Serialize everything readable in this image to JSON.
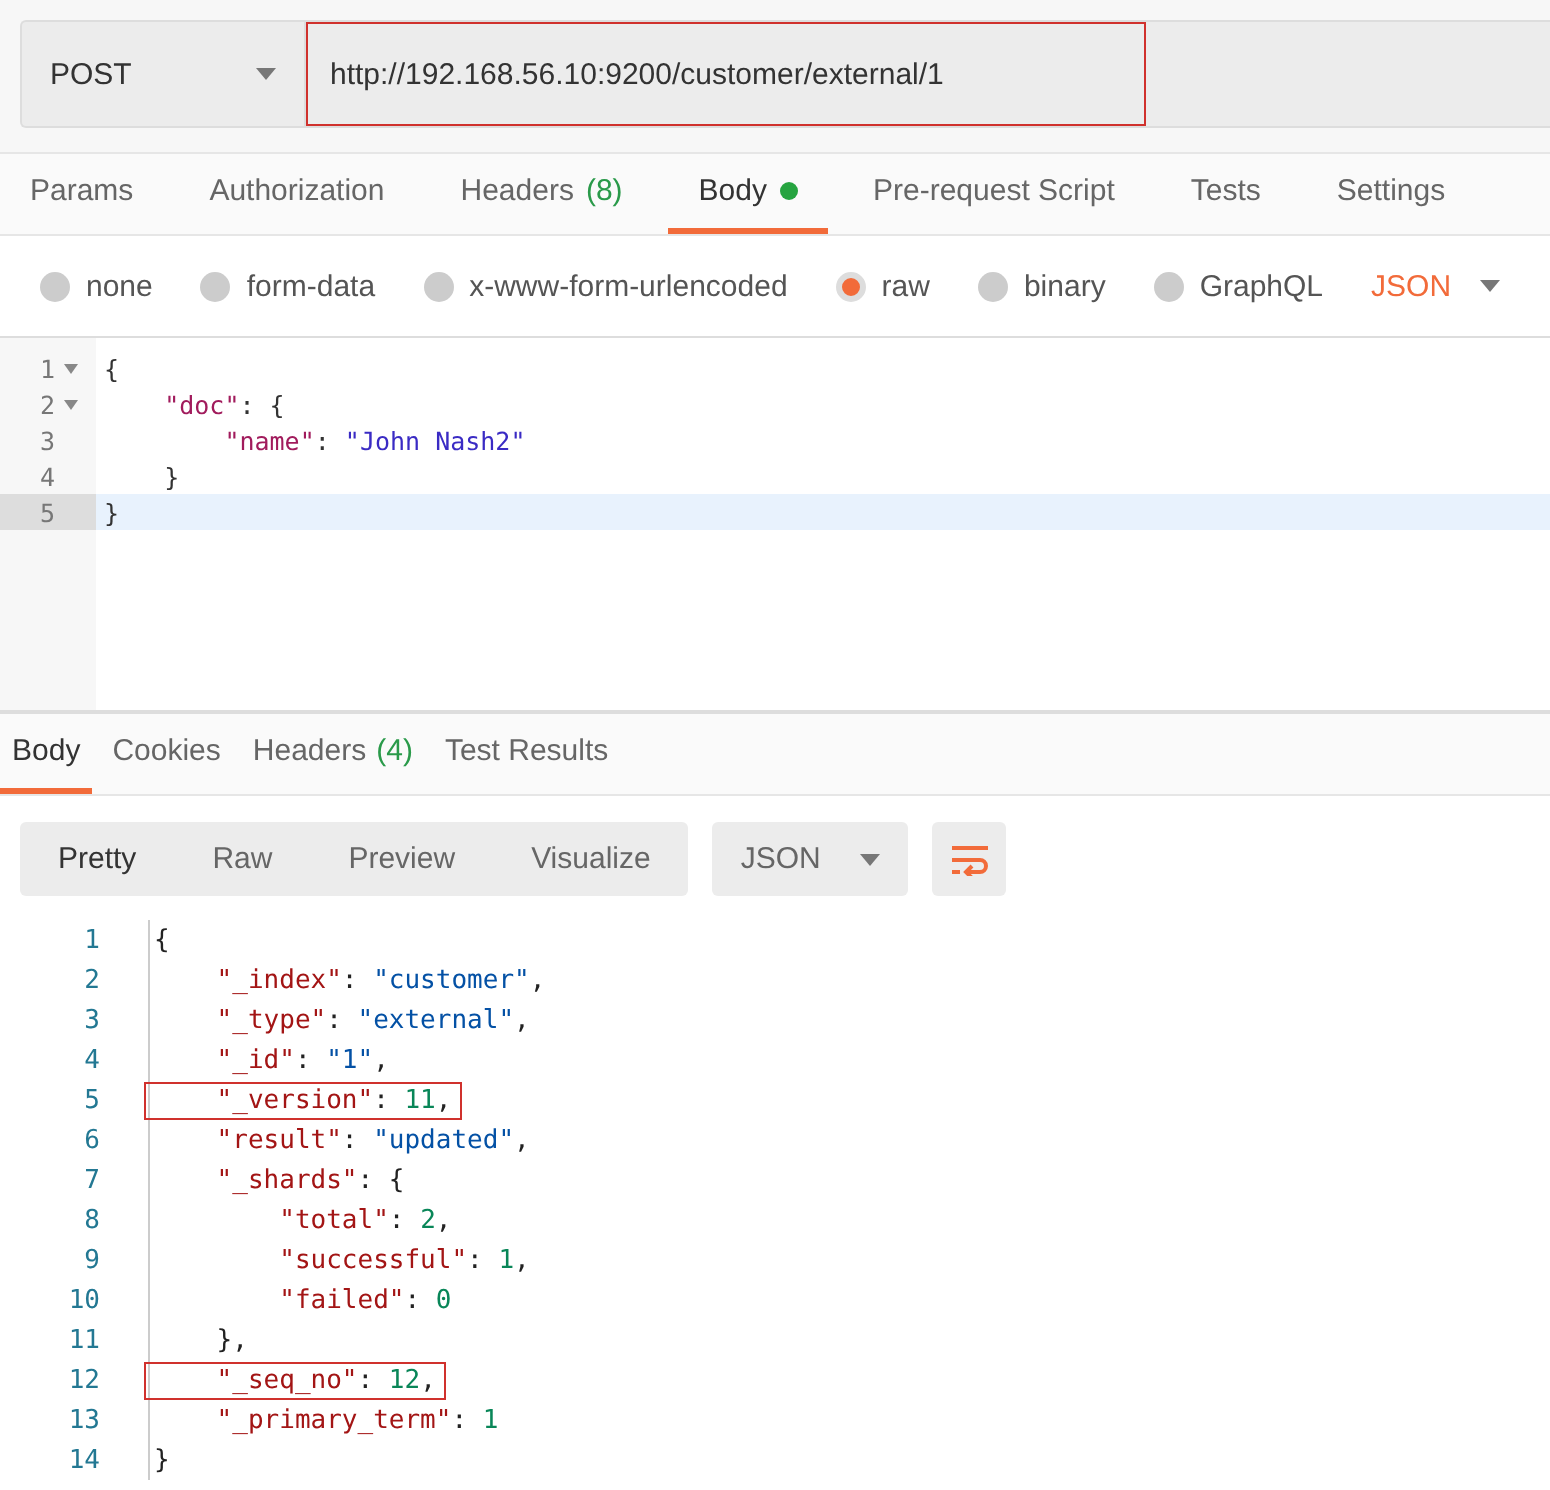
{
  "request_bar": {
    "method": "POST",
    "url": "http://192.168.56.10:9200/customer/external/1",
    "url_highlighted": true
  },
  "request_tabs": [
    {
      "label": "Params",
      "selected": false
    },
    {
      "label": "Authorization",
      "selected": false
    },
    {
      "label": "Headers",
      "count": "(8)",
      "selected": false
    },
    {
      "label": "Body",
      "selected": true,
      "dot": true
    },
    {
      "label": "Pre-request Script",
      "selected": false
    },
    {
      "label": "Tests",
      "selected": false
    },
    {
      "label": "Settings",
      "selected": false
    }
  ],
  "body_types": [
    {
      "label": "none",
      "selected": false
    },
    {
      "label": "form-data",
      "selected": false
    },
    {
      "label": "x-www-form-urlencoded",
      "selected": false
    },
    {
      "label": "raw",
      "selected": true
    },
    {
      "label": "binary",
      "selected": false
    },
    {
      "label": "GraphQL",
      "selected": false
    }
  ],
  "body_format": "JSON",
  "request_editor": [
    {
      "number": "1",
      "fold": true,
      "active": false,
      "tokens": [
        {
          "kind": "punct",
          "text": "{"
        }
      ]
    },
    {
      "number": "2",
      "fold": true,
      "active": false,
      "tokens": [
        {
          "kind": "key",
          "text": "    \"doc\""
        },
        {
          "kind": "punct",
          "text": ": {"
        }
      ]
    },
    {
      "number": "3",
      "fold": false,
      "active": false,
      "tokens": [
        {
          "kind": "key",
          "text": "        \"name\""
        },
        {
          "kind": "punct",
          "text": ": "
        },
        {
          "kind": "string",
          "text": "\"John Nash2\""
        }
      ]
    },
    {
      "number": "4",
      "fold": false,
      "active": false,
      "tokens": [
        {
          "kind": "punct",
          "text": "    }"
        }
      ]
    },
    {
      "number": "5",
      "fold": false,
      "active": true,
      "tokens": [
        {
          "kind": "punct",
          "text": "}"
        }
      ]
    }
  ],
  "response_tabs": [
    {
      "label": "Body",
      "selected": true
    },
    {
      "label": "Cookies",
      "selected": false
    },
    {
      "label": "Headers",
      "count": "(4)",
      "selected": false
    },
    {
      "label": "Test Results",
      "selected": false
    }
  ],
  "view_modes": [
    {
      "label": "Pretty",
      "selected": true
    },
    {
      "label": "Raw",
      "selected": false
    },
    {
      "label": "Preview",
      "selected": false
    },
    {
      "label": "Visualize",
      "selected": false
    }
  ],
  "response_format": "JSON",
  "response_body": [
    {
      "number": "1",
      "highlighted": false,
      "tokens": [
        {
          "kind": "punct",
          "text": "{"
        }
      ]
    },
    {
      "number": "2",
      "highlighted": false,
      "tokens": [
        {
          "kind": "key",
          "text": "    \"_index\""
        },
        {
          "kind": "punct",
          "text": ": "
        },
        {
          "kind": "string",
          "text": "\"customer\""
        },
        {
          "kind": "punct",
          "text": ","
        }
      ]
    },
    {
      "number": "3",
      "highlighted": false,
      "tokens": [
        {
          "kind": "key",
          "text": "    \"_type\""
        },
        {
          "kind": "punct",
          "text": ": "
        },
        {
          "kind": "string",
          "text": "\"external\""
        },
        {
          "kind": "punct",
          "text": ","
        }
      ]
    },
    {
      "number": "4",
      "highlighted": false,
      "tokens": [
        {
          "kind": "key",
          "text": "    \"_id\""
        },
        {
          "kind": "punct",
          "text": ": "
        },
        {
          "kind": "string",
          "text": "\"1\""
        },
        {
          "kind": "punct",
          "text": ","
        }
      ]
    },
    {
      "number": "5",
      "highlighted": true,
      "tokens": [
        {
          "kind": "key",
          "text": "    \"_version\""
        },
        {
          "kind": "punct",
          "text": ": "
        },
        {
          "kind": "number",
          "text": "11"
        },
        {
          "kind": "punct",
          "text": ","
        }
      ]
    },
    {
      "number": "6",
      "highlighted": false,
      "tokens": [
        {
          "kind": "key",
          "text": "    \"result\""
        },
        {
          "kind": "punct",
          "text": ": "
        },
        {
          "kind": "string",
          "text": "\"updated\""
        },
        {
          "kind": "punct",
          "text": ","
        }
      ]
    },
    {
      "number": "7",
      "highlighted": false,
      "tokens": [
        {
          "kind": "key",
          "text": "    \"_shards\""
        },
        {
          "kind": "punct",
          "text": ": {"
        }
      ]
    },
    {
      "number": "8",
      "highlighted": false,
      "tokens": [
        {
          "kind": "key",
          "text": "        \"total\""
        },
        {
          "kind": "punct",
          "text": ": "
        },
        {
          "kind": "number",
          "text": "2"
        },
        {
          "kind": "punct",
          "text": ","
        }
      ]
    },
    {
      "number": "9",
      "highlighted": false,
      "tokens": [
        {
          "kind": "key",
          "text": "        \"successful\""
        },
        {
          "kind": "punct",
          "text": ": "
        },
        {
          "kind": "number",
          "text": "1"
        },
        {
          "kind": "punct",
          "text": ","
        }
      ]
    },
    {
      "number": "10",
      "highlighted": false,
      "tokens": [
        {
          "kind": "key",
          "text": "        \"failed\""
        },
        {
          "kind": "punct",
          "text": ": "
        },
        {
          "kind": "number",
          "text": "0"
        }
      ]
    },
    {
      "number": "11",
      "highlighted": false,
      "tokens": [
        {
          "kind": "punct",
          "text": "    },"
        }
      ]
    },
    {
      "number": "12",
      "highlighted": true,
      "tokens": [
        {
          "kind": "key",
          "text": "    \"_seq_no\""
        },
        {
          "kind": "punct",
          "text": ": "
        },
        {
          "kind": "number",
          "text": "12"
        },
        {
          "kind": "punct",
          "text": ","
        }
      ]
    },
    {
      "number": "13",
      "highlighted": false,
      "tokens": [
        {
          "kind": "key",
          "text": "    \"_primary_term\""
        },
        {
          "kind": "punct",
          "text": ": "
        },
        {
          "kind": "number",
          "text": "1"
        }
      ]
    },
    {
      "number": "14",
      "highlighted": false,
      "tokens": [
        {
          "kind": "punct",
          "text": "}"
        }
      ]
    }
  ]
}
